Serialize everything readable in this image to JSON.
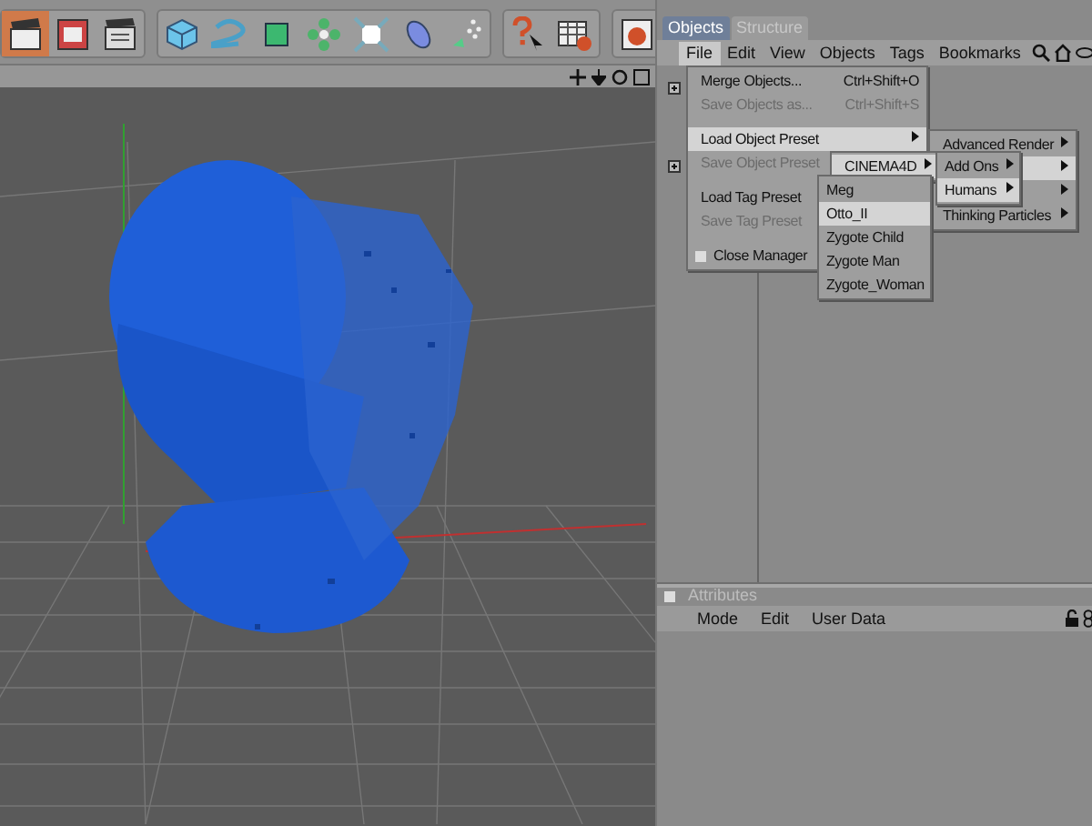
{
  "toolbar": {
    "groups": [
      [
        {
          "kind": "clapper",
          "selected": true
        },
        {
          "kind": "render",
          "selected": false
        },
        {
          "kind": "settings",
          "selected": false
        }
      ],
      [
        {
          "kind": "cube",
          "selected": false
        },
        {
          "kind": "spline",
          "selected": false
        },
        {
          "kind": "nurbs",
          "selected": false
        },
        {
          "kind": "array",
          "selected": false
        },
        {
          "kind": "deformer",
          "selected": false
        },
        {
          "kind": "floor",
          "selected": false
        },
        {
          "kind": "particles",
          "selected": false
        }
      ],
      [
        {
          "kind": "help",
          "selected": false
        },
        {
          "kind": "tablehelp",
          "selected": false
        }
      ],
      [
        {
          "kind": "globe",
          "selected": false
        }
      ]
    ]
  },
  "objects_manager": {
    "tabs": [
      {
        "label": "Objects",
        "selected": true
      },
      {
        "label": "Structure",
        "selected": false
      }
    ],
    "menu": [
      {
        "label": "File",
        "selected": true
      },
      {
        "label": "Edit",
        "selected": false
      },
      {
        "label": "View",
        "selected": false
      },
      {
        "label": "Objects",
        "selected": false
      },
      {
        "label": "Tags",
        "selected": false
      },
      {
        "label": "Bookmarks",
        "selected": false
      }
    ]
  },
  "file_menu": [
    {
      "kind": "item",
      "label": "Merge Objects...",
      "shortcut": "Ctrl+Shift+O",
      "disabled": false,
      "highlighted": false
    },
    {
      "kind": "item",
      "label": "Save Objects as...",
      "shortcut": "Ctrl+Shift+S",
      "disabled": true,
      "highlighted": false
    },
    {
      "kind": "separator"
    },
    {
      "kind": "item",
      "label": "Load Object Preset",
      "disabled": false,
      "highlighted": true,
      "submenu": true
    },
    {
      "kind": "item",
      "label": "Save Object Preset",
      "disabled": true,
      "highlighted": false
    },
    {
      "kind": "separator"
    },
    {
      "kind": "item",
      "label": "Load Tag Preset",
      "disabled": false,
      "highlighted": false
    },
    {
      "kind": "item",
      "label": "Save Tag Preset",
      "disabled": true,
      "highlighted": false
    },
    {
      "kind": "separator"
    },
    {
      "kind": "check",
      "label": "Close Manager",
      "checked": false,
      "disabled": false,
      "highlighted": false
    }
  ],
  "preset_menu": [
    {
      "label": "Advanced Render",
      "highlighted": false,
      "submenu": true
    },
    {
      "highlighted": true,
      "submenu": true
    },
    {
      "highlighted": false,
      "submenu": true
    },
    {
      "label": "Thinking Particles",
      "highlighted": false,
      "submenu": true
    }
  ],
  "cinema4d_menu": [
    {
      "label": "CINEMA4D",
      "highlighted": true,
      "submenu": true
    }
  ],
  "addons_menu": [
    {
      "label": "Add Ons",
      "highlighted": false,
      "submenu": true
    },
    {
      "label": "Humans",
      "highlighted": true,
      "submenu": true
    }
  ],
  "humans_menu": [
    {
      "label": "Meg",
      "highlighted": false
    },
    {
      "label": "Otto_II",
      "highlighted": true
    },
    {
      "label": "Zygote Child",
      "highlighted": false
    },
    {
      "label": "Zygote Man",
      "highlighted": false
    },
    {
      "label": "Zygote_Woman",
      "highlighted": false
    }
  ],
  "attributes": {
    "title": "Attributes",
    "menu": [
      "Mode",
      "Edit",
      "User Data"
    ]
  }
}
